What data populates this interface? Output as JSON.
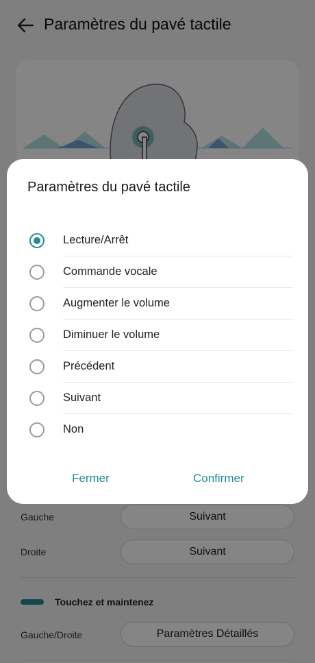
{
  "header": {
    "title": "Paramètres du pavé tactile",
    "back_icon": "arrow-left-icon"
  },
  "settings": {
    "rows": [
      {
        "label": "Gauche",
        "value": "Suivant"
      },
      {
        "label": "Droite",
        "value": "Suivant"
      }
    ],
    "section_title": "Touchez et maintenez",
    "hold_row": {
      "label": "Gauche/Droite",
      "value": "Paramètres Détaillés"
    }
  },
  "dialog": {
    "title": "Paramètres du pavé tactile",
    "options": [
      {
        "label": "Lecture/Arrêt",
        "selected": true
      },
      {
        "label": "Commande vocale",
        "selected": false
      },
      {
        "label": "Augmenter le volume",
        "selected": false
      },
      {
        "label": "Diminuer le volume",
        "selected": false
      },
      {
        "label": "Précédent",
        "selected": false
      },
      {
        "label": "Suivant",
        "selected": false
      },
      {
        "label": "Non",
        "selected": false
      }
    ],
    "cancel_label": "Fermer",
    "confirm_label": "Confirmer"
  },
  "colors": {
    "accent": "#1f8b96",
    "dialog_bg": "#ffffff",
    "page_bg": "#f4f4f4"
  }
}
